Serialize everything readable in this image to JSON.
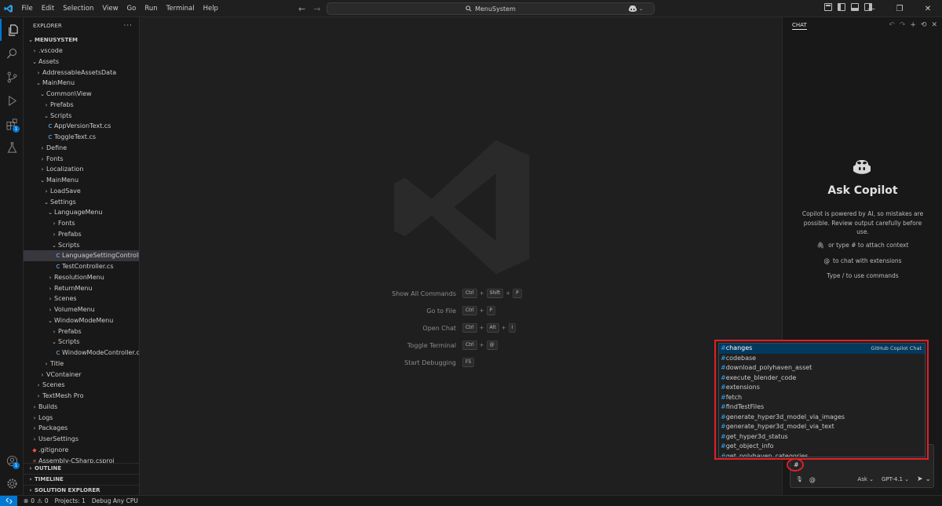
{
  "titlebar": {
    "menus": [
      "File",
      "Edit",
      "Selection",
      "View",
      "Go",
      "Run",
      "Terminal",
      "Help"
    ],
    "search_text": "MenuSystem"
  },
  "activity": {
    "extensions_badge": "1",
    "accounts_badge": "1"
  },
  "explorer": {
    "header": "EXPLORER",
    "root": "MENUSYSTEM",
    "tree": [
      {
        "label": ".vscode",
        "depth": 1,
        "kind": "folder-closed"
      },
      {
        "label": "Assets",
        "depth": 1,
        "kind": "folder-open"
      },
      {
        "label": "AddressableAssetsData",
        "depth": 2,
        "kind": "folder-closed"
      },
      {
        "label": "MainMenu",
        "depth": 2,
        "kind": "folder-open"
      },
      {
        "label": "Common\\View",
        "depth": 3,
        "kind": "folder-open"
      },
      {
        "label": "Prefabs",
        "depth": 4,
        "kind": "folder-closed"
      },
      {
        "label": "Scripts",
        "depth": 4,
        "kind": "folder-open"
      },
      {
        "label": "AppVersionText.cs",
        "depth": 5,
        "kind": "cs"
      },
      {
        "label": "ToggleText.cs",
        "depth": 5,
        "kind": "cs"
      },
      {
        "label": "Define",
        "depth": 3,
        "kind": "folder-closed"
      },
      {
        "label": "Fonts",
        "depth": 3,
        "kind": "folder-closed"
      },
      {
        "label": "Localization",
        "depth": 3,
        "kind": "folder-closed"
      },
      {
        "label": "MainMenu",
        "depth": 3,
        "kind": "folder-open"
      },
      {
        "label": "LoadSave",
        "depth": 4,
        "kind": "folder-closed"
      },
      {
        "label": "Settings",
        "depth": 4,
        "kind": "folder-open"
      },
      {
        "label": "LanguageMenu",
        "depth": 5,
        "kind": "folder-open"
      },
      {
        "label": "Fonts",
        "depth": 6,
        "kind": "folder-closed"
      },
      {
        "label": "Prefabs",
        "depth": 6,
        "kind": "folder-closed"
      },
      {
        "label": "Scripts",
        "depth": 6,
        "kind": "folder-open"
      },
      {
        "label": "LanguageSettingControll...",
        "depth": 7,
        "kind": "cs",
        "selected": true
      },
      {
        "label": "TestController.cs",
        "depth": 7,
        "kind": "cs"
      },
      {
        "label": "ResolutionMenu",
        "depth": 5,
        "kind": "folder-closed"
      },
      {
        "label": "ReturnMenu",
        "depth": 5,
        "kind": "folder-closed"
      },
      {
        "label": "Scenes",
        "depth": 5,
        "kind": "folder-closed"
      },
      {
        "label": "VolumeMenu",
        "depth": 5,
        "kind": "folder-closed"
      },
      {
        "label": "WindowModeMenu",
        "depth": 5,
        "kind": "folder-open"
      },
      {
        "label": "Prefabs",
        "depth": 6,
        "kind": "folder-closed"
      },
      {
        "label": "Scripts",
        "depth": 6,
        "kind": "folder-open"
      },
      {
        "label": "WindowModeController.cs",
        "depth": 7,
        "kind": "cs"
      },
      {
        "label": "Title",
        "depth": 4,
        "kind": "folder-closed"
      },
      {
        "label": "VContainer",
        "depth": 3,
        "kind": "folder-closed"
      },
      {
        "label": "Scenes",
        "depth": 2,
        "kind": "folder-closed"
      },
      {
        "label": "TextMesh Pro",
        "depth": 2,
        "kind": "folder-closed"
      },
      {
        "label": "Builds",
        "depth": 1,
        "kind": "folder-closed"
      },
      {
        "label": "Logs",
        "depth": 1,
        "kind": "folder-closed"
      },
      {
        "label": "Packages",
        "depth": 1,
        "kind": "folder-closed"
      },
      {
        "label": "UserSettings",
        "depth": 1,
        "kind": "folder-closed"
      },
      {
        "label": ".gitignore",
        "depth": 1,
        "kind": "git"
      },
      {
        "label": "Assembly-CSharp.csproj",
        "depth": 1,
        "kind": "xml"
      }
    ],
    "sections": [
      "OUTLINE",
      "TIMELINE",
      "SOLUTION EXPLORER"
    ]
  },
  "editor": {
    "shortcuts": [
      {
        "label": "Show All Commands",
        "keys": [
          "Ctrl",
          "Shift",
          "P"
        ]
      },
      {
        "label": "Go to File",
        "keys": [
          "Ctrl",
          "P"
        ]
      },
      {
        "label": "Open Chat",
        "keys": [
          "Ctrl",
          "Alt",
          "I"
        ]
      },
      {
        "label": "Toggle Terminal",
        "keys": [
          "Ctrl",
          "@"
        ]
      },
      {
        "label": "Start Debugging",
        "keys": [
          "F5"
        ]
      }
    ]
  },
  "chat": {
    "tab": "CHAT",
    "title": "Ask Copilot",
    "disclaimer": "Copilot is powered by AI, so mistakes are possible. Review output carefully before use.",
    "hint_attach": "or type # to attach context",
    "hint_extensions": "to chat with extensions",
    "hint_commands": "Type / to use commands",
    "input_value": "#",
    "mode": "Ask",
    "model": "GPT-4.1"
  },
  "suggestions": {
    "source": "GitHub Copilot Chat",
    "items": [
      "changes",
      "codebase",
      "download_polyhaven_asset",
      "execute_blender_code",
      "extensions",
      "fetch",
      "findTestFiles",
      "generate_hyper3d_model_via_images",
      "generate_hyper3d_model_via_text",
      "get_hyper3d_status",
      "get_object_info",
      "get_polyhaven_categories"
    ]
  },
  "statusbar": {
    "errors": "0",
    "warnings": "0",
    "projects": "Projects: 1",
    "debug": "Debug Any CPU"
  },
  "colors": {
    "accent": "#0078d4",
    "highlight_red": "#e0202a",
    "selection": "#04395e"
  }
}
